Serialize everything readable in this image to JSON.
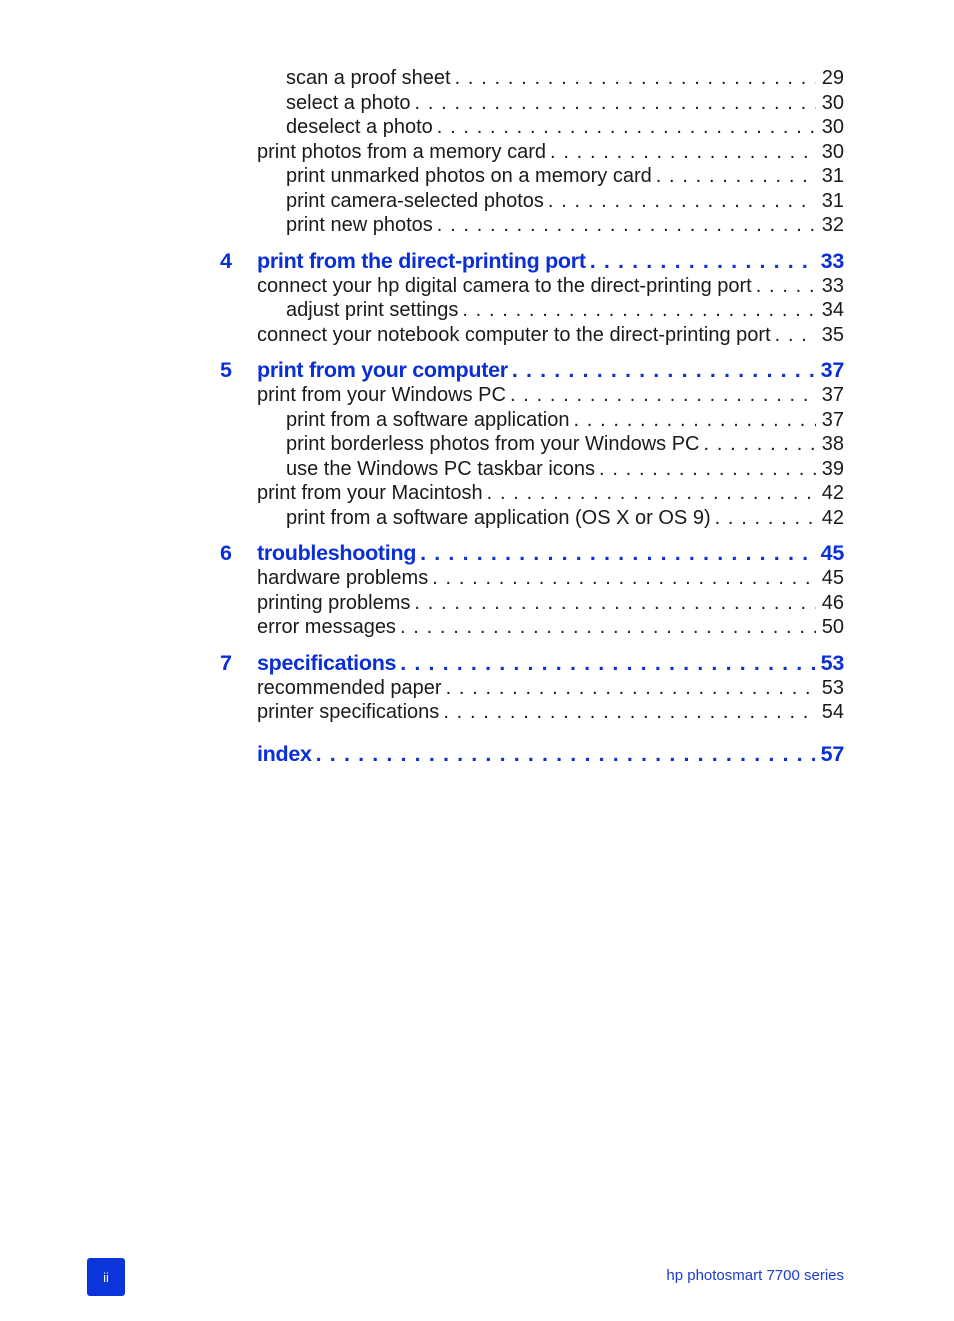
{
  "toc": {
    "entries": [
      {
        "kind": "entry",
        "level": 2,
        "title": "scan a proof sheet",
        "page": "29"
      },
      {
        "kind": "entry",
        "level": 2,
        "title": "select a photo",
        "page": "30"
      },
      {
        "kind": "entry",
        "level": 2,
        "title": "deselect a photo",
        "page": "30"
      },
      {
        "kind": "entry",
        "level": 1,
        "title": "print photos from a memory card",
        "page": "30"
      },
      {
        "kind": "entry",
        "level": 2,
        "title": "print unmarked photos on a memory card",
        "page": "31"
      },
      {
        "kind": "entry",
        "level": 2,
        "title": "print camera-selected photos",
        "page": "31"
      },
      {
        "kind": "entry",
        "level": 2,
        "title": "print new photos",
        "page": "32"
      },
      {
        "kind": "chapter",
        "number": "4",
        "title": "print from the direct-printing port",
        "page": "33"
      },
      {
        "kind": "entry",
        "level": 1,
        "title": "connect your hp digital camera to the direct-printing port",
        "page": "33"
      },
      {
        "kind": "entry",
        "level": 2,
        "title": "adjust print settings",
        "page": "34"
      },
      {
        "kind": "entry",
        "level": 1,
        "title": "connect your notebook computer to the direct-printing port",
        "page": "35"
      },
      {
        "kind": "chapter",
        "number": "5",
        "title": "print from your computer",
        "page": "37"
      },
      {
        "kind": "entry",
        "level": 1,
        "title": "print from your Windows PC",
        "page": "37"
      },
      {
        "kind": "entry",
        "level": 2,
        "title": "print from a software application",
        "page": "37"
      },
      {
        "kind": "entry",
        "level": 2,
        "title": "print borderless photos from your Windows PC",
        "page": "38"
      },
      {
        "kind": "entry",
        "level": 2,
        "title": "use the Windows PC taskbar icons",
        "page": "39"
      },
      {
        "kind": "entry",
        "level": 1,
        "title": "print from your Macintosh",
        "page": "42"
      },
      {
        "kind": "entry",
        "level": 2,
        "title": "print from a software application (OS X or OS 9)",
        "page": "42"
      },
      {
        "kind": "chapter",
        "number": "6",
        "title": "troubleshooting",
        "page": "45"
      },
      {
        "kind": "entry",
        "level": 1,
        "title": "hardware problems",
        "page": "45"
      },
      {
        "kind": "entry",
        "level": 1,
        "title": "printing problems",
        "page": "46"
      },
      {
        "kind": "entry",
        "level": 1,
        "title": "error messages",
        "page": "50"
      },
      {
        "kind": "chapter",
        "number": "7",
        "title": "specifications",
        "page": "53"
      },
      {
        "kind": "entry",
        "level": 1,
        "title": "recommended paper",
        "page": "53"
      },
      {
        "kind": "entry",
        "level": 1,
        "title": "printer specifications",
        "page": "54"
      },
      {
        "kind": "chapter",
        "number": "",
        "title": "index",
        "page": "57"
      }
    ]
  },
  "footer": {
    "page_number": "ii",
    "product": "hp photosmart 7700 series"
  },
  "colors": {
    "accent": "#0b2fd6",
    "badge": "#0b34d9",
    "text": "#1a1a1a"
  }
}
